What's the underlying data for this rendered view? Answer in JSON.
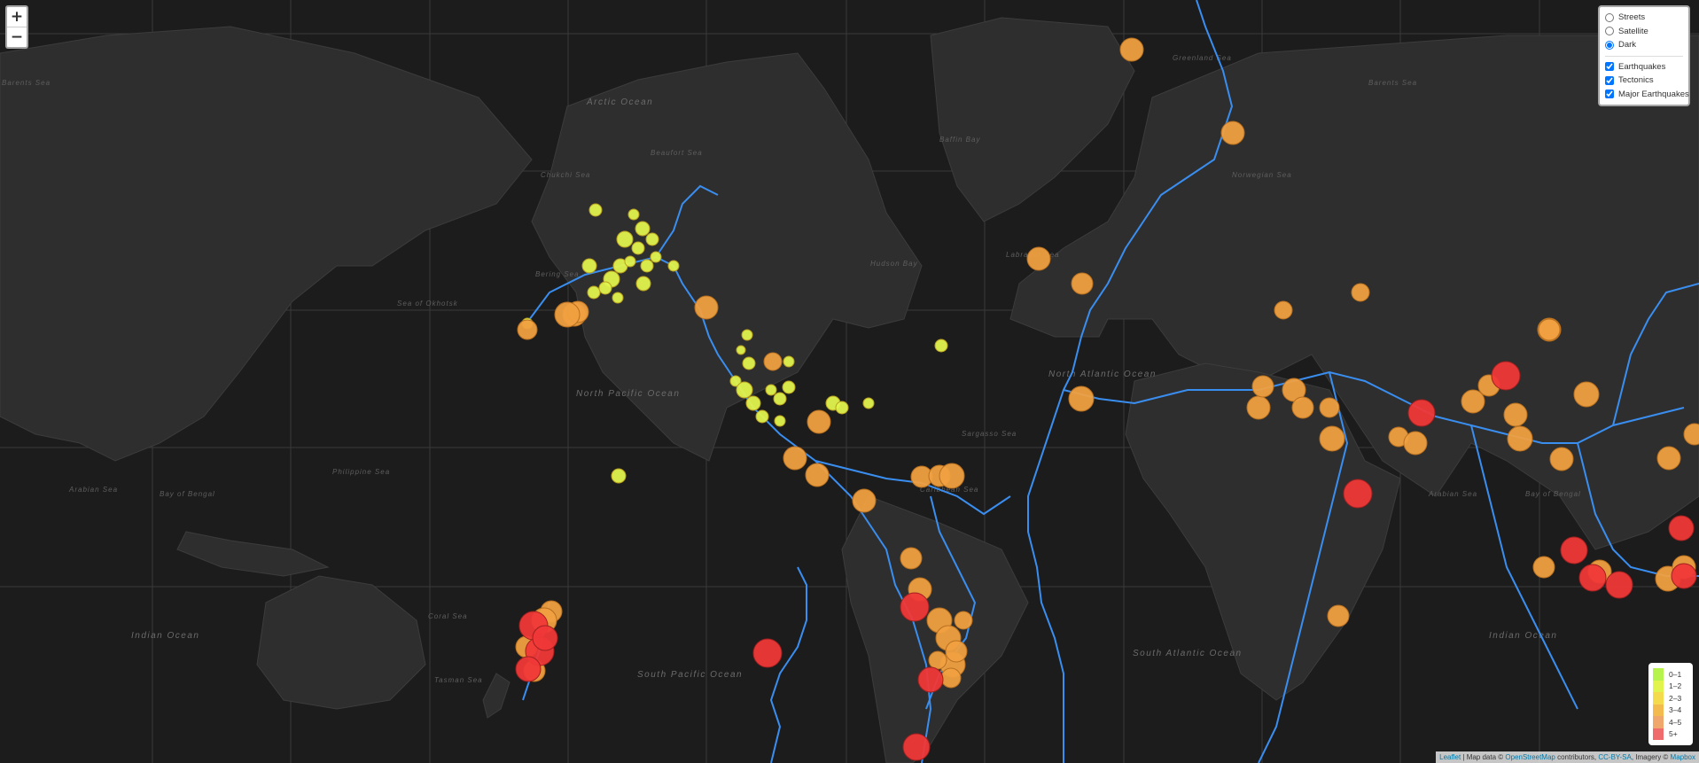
{
  "map": {
    "ocean_labels": [
      "Arctic Ocean",
      "North Pacific Ocean",
      "South Pacific Ocean",
      "Indian Ocean",
      "Indian Ocean",
      "North Atlantic Ocean",
      "South Atlantic Ocean"
    ],
    "sea_labels": [
      "Greenland Sea",
      "Barents Sea",
      "Norwegian Sea",
      "Bering Sea",
      "Chukchi Sea",
      "Beaufort Sea",
      "Sea of Okhotsk",
      "Philippine Sea",
      "Arabian Sea",
      "Bay of Bengal",
      "Coral Sea",
      "Tasman Sea",
      "Sargasso Sea",
      "Caribbean Sea",
      "Hudson Bay",
      "Labrador Sea",
      "Baffin Bay",
      "Arabian Sea",
      "Bay of Bengal",
      "Barents Sea"
    ]
  },
  "zoom": {
    "in_label": "+",
    "out_label": "−"
  },
  "layers": {
    "base": [
      {
        "label": "Streets",
        "checked": false
      },
      {
        "label": "Satellite",
        "checked": false
      },
      {
        "label": "Dark",
        "checked": true
      }
    ],
    "overlays": [
      {
        "label": "Earthquakes",
        "checked": true
      },
      {
        "label": "Tectonics",
        "checked": true
      },
      {
        "label": "Major Earthquakes",
        "checked": true
      }
    ]
  },
  "legend": [
    {
      "label": "0–1",
      "color": "#b7f34d"
    },
    {
      "label": "1–2",
      "color": "#e1f34d"
    },
    {
      "label": "2–3",
      "color": "#f3db4d"
    },
    {
      "label": "3–4",
      "color": "#f3ba4d"
    },
    {
      "label": "4–5",
      "color": "#f0a76b"
    },
    {
      "label": "5+",
      "color": "#f06b6b"
    }
  ],
  "attribution": {
    "leaflet": "Leaflet",
    "sep": " | Map data © ",
    "osm": "OpenStreetMap",
    "contrib": " contributors, ",
    "license": "CC-BY-SA",
    "imagery": ", Imagery © ",
    "mapbox": "Mapbox"
  },
  "colors": {
    "plate": "#3a8ef0",
    "yellow": "#f3db4d",
    "yellowgreen": "#e1f34d",
    "orange": "#f0a040",
    "red": "#f03838"
  }
}
